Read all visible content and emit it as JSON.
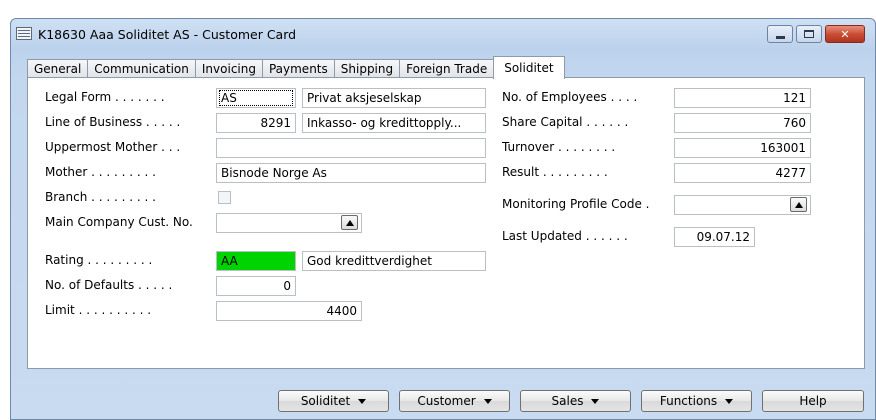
{
  "window": {
    "title": "K18630 Aaa Soliditet AS - Customer Card"
  },
  "tabs": [
    "General",
    "Communication",
    "Invoicing",
    "Payments",
    "Shipping",
    "Foreign Trade",
    "Soliditet"
  ],
  "active_tab": "Soliditet",
  "left": {
    "legal_form": {
      "label": "Legal Form . . . . . . .",
      "code": "AS",
      "description": "Privat aksjeselskap"
    },
    "line_of_business": {
      "label": "Line of Business . . . . .",
      "code": "8291",
      "description": "Inkasso- og kredittopply..."
    },
    "uppermost_mother": {
      "label": "Uppermost Mother . . .",
      "value": ""
    },
    "mother": {
      "label": "Mother . . . . . . . . .",
      "value": "Bisnode Norge As"
    },
    "branch": {
      "label": "Branch . . . . . . . . .",
      "checked": false
    },
    "main_company": {
      "label": "Main Company Cust. No.",
      "value": ""
    },
    "rating": {
      "label": "Rating . . . . . . . . .",
      "code": "AA",
      "description": "God kredittverdighet",
      "color": "#00d400"
    },
    "no_of_defaults": {
      "label": "No. of Defaults . . . . .",
      "value": "0"
    },
    "limit": {
      "label": "Limit . . . . . . . . . .",
      "value": "4400"
    }
  },
  "right": {
    "no_of_employees": {
      "label": "No. of Employees . . . .",
      "value": "121"
    },
    "share_capital": {
      "label": "Share Capital . . . . . .",
      "value": "760"
    },
    "turnover": {
      "label": "Turnover . . . . . . . .",
      "value": "163001"
    },
    "result": {
      "label": "Result . . . . . . . . .",
      "value": "4277"
    },
    "monitoring_profile": {
      "label": "Monitoring Profile Code .",
      "value": ""
    },
    "last_updated": {
      "label": "Last Updated . . . . . .",
      "value": "09.07.12"
    }
  },
  "buttons": {
    "soliditet": "Soliditet",
    "customer": "Customer",
    "sales": "Sales",
    "functions": "Functions",
    "help": "Help"
  }
}
